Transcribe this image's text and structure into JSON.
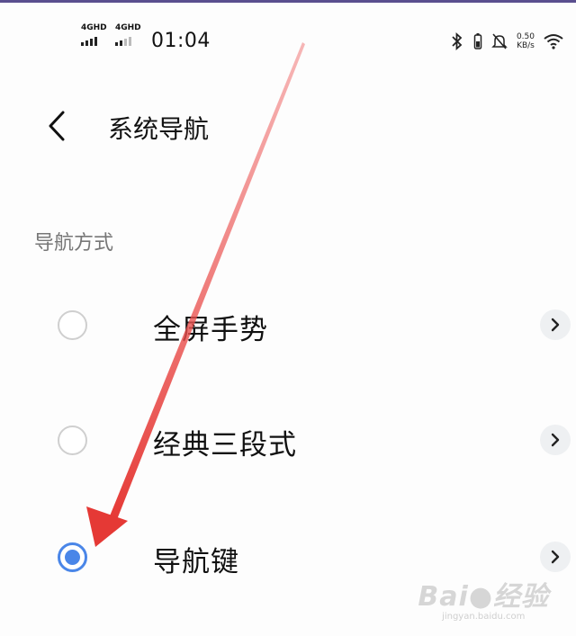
{
  "status_bar": {
    "sim1_label": "4GHD",
    "sim2_label": "4GHD",
    "time": "01:04",
    "speed_value": "0.50",
    "speed_unit": "KB/s",
    "icons": [
      "signal-icon",
      "bluetooth-icon",
      "battery-icon",
      "mute-icon",
      "wifi-icon"
    ]
  },
  "header": {
    "back_icon": "back-chevron-icon",
    "title": "系统导航"
  },
  "section": {
    "label": "导航方式"
  },
  "options": [
    {
      "label": "全屏手势",
      "selected": false
    },
    {
      "label": "经典三段式",
      "selected": false
    },
    {
      "label": "导航键",
      "selected": true
    }
  ],
  "colors": {
    "accent": "#4a86e8",
    "annotation_arrow": "#e53935",
    "top_border": "#5a4f8f"
  },
  "watermark": {
    "text": "Bai",
    "text2": "经验",
    "sub": "jingyan.baidu.com"
  }
}
